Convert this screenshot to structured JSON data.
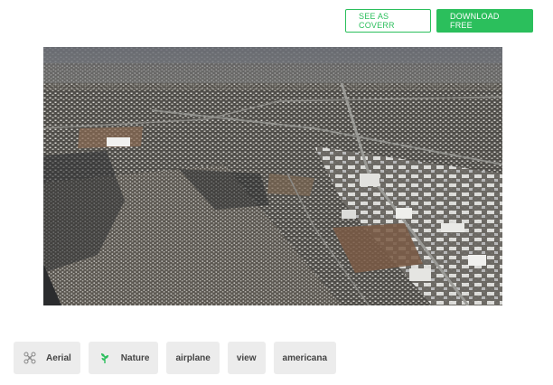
{
  "header": {
    "see_as_cover_label": "SEE AS COVERR",
    "download_label": "DOWNLOAD FREE"
  },
  "colors": {
    "accent": "#2bbf5c",
    "tag_bg": "#ececec"
  },
  "tags": [
    {
      "label": "Aerial",
      "icon": "drone-icon"
    },
    {
      "label": "Nature",
      "icon": "plant-icon"
    },
    {
      "label": "airplane"
    },
    {
      "label": "view"
    },
    {
      "label": "americana"
    }
  ]
}
